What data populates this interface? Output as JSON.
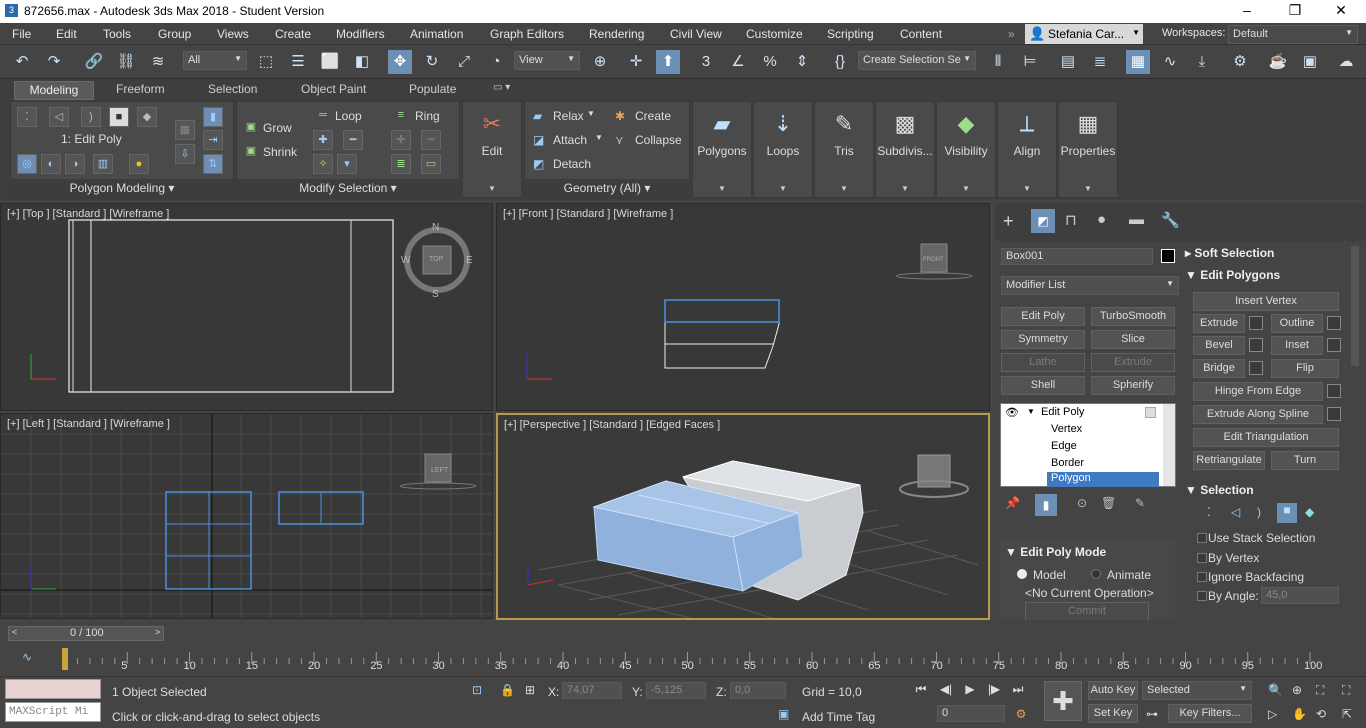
{
  "window": {
    "title": "872656.max - Autodesk 3ds Max 2018 - Student Version",
    "controls": [
      "–",
      "❐",
      "✕"
    ]
  },
  "menu": [
    "File",
    "Edit",
    "Tools",
    "Group",
    "Views",
    "Create",
    "Modifiers",
    "Animation",
    "Graph Editors",
    "Rendering",
    "Civil View",
    "Customize",
    "Scripting",
    "Content"
  ],
  "user": {
    "name": "Stefania Car...",
    "workspaces_label": "Workspaces:",
    "workspace": "Default"
  },
  "toolbar": {
    "filter": "All",
    "ref_coord": "View",
    "selection_set": "Create Selection Se"
  },
  "ribbon": {
    "tabs": [
      "Modeling",
      "Freeform",
      "Selection",
      "Object Paint",
      "Populate"
    ],
    "active_tab": "Modeling",
    "edit_poly_label": "1: Edit Poly",
    "panel_polygon_modeling": "Polygon Modeling",
    "grow": "Grow",
    "shrink": "Shrink",
    "loop": "Loop",
    "ring": "Ring",
    "panel_modify_selection": "Modify Selection",
    "edit": "Edit",
    "relax": "Relax",
    "attach": "Attach",
    "detach": "Detach",
    "create": "Create",
    "collapse": "Collapse",
    "panel_geometry": "Geometry (All)",
    "big_buttons": [
      "Polygons",
      "Loops",
      "Tris",
      "Subdivis...",
      "Visibility",
      "Align",
      "Properties"
    ]
  },
  "viewports": {
    "top": "[+] [Top ] [Standard ] [Wireframe ]",
    "front": "[+] [Front ] [Standard ] [Wireframe ]",
    "left": "[+] [Left ] [Standard ] [Wireframe ]",
    "perspective": "[+] [Perspective ] [Standard ] [Edged Faces ]",
    "compass": {
      "n": "N",
      "s": "S",
      "e": "E",
      "w": "W",
      "cube_top": "TOP",
      "cube_front": "FRONT",
      "cube_left": "LEFT"
    }
  },
  "command_panel": {
    "object_name": "Box001",
    "modifier_list": "Modifier List",
    "modifier_buttons": [
      {
        "label": "Edit Poly",
        "enabled": true
      },
      {
        "label": "TurboSmooth",
        "enabled": true
      },
      {
        "label": "Symmetry",
        "enabled": true
      },
      {
        "label": "Slice",
        "enabled": true
      },
      {
        "label": "Lathe",
        "enabled": false
      },
      {
        "label": "Extrude",
        "enabled": false
      },
      {
        "label": "Shell",
        "enabled": true
      },
      {
        "label": "Spherify",
        "enabled": true
      }
    ],
    "stack": [
      "Edit Poly",
      "Vertex",
      "Edge",
      "Border",
      "Polygon"
    ],
    "edit_poly_mode": {
      "title": "Edit Poly Mode",
      "model": "Model",
      "animate": "Animate",
      "operation": "<No Current Operation>",
      "commit": "Commit"
    },
    "soft_selection": "Soft Selection",
    "edit_polygons": {
      "title": "Edit Polygons",
      "insert_vertex": "Insert Vertex",
      "extrude": "Extrude",
      "outline": "Outline",
      "bevel": "Bevel",
      "inset": "Inset",
      "bridge": "Bridge",
      "flip": "Flip",
      "hinge": "Hinge From Edge",
      "extrude_spline": "Extrude Along Spline",
      "edit_tri": "Edit Triangulation",
      "retriangulate": "Retriangulate",
      "turn": "Turn"
    },
    "selection": {
      "title": "Selection",
      "use_stack": "Use Stack Selection",
      "by_vertex": "By Vertex",
      "ignore_backfacing": "Ignore Backfacing",
      "by_angle": "By Angle:",
      "angle": "45,0"
    }
  },
  "timeline": {
    "frame": "0 / 100",
    "ticks": [
      "5",
      "10",
      "15",
      "20",
      "25",
      "30",
      "35",
      "40",
      "45",
      "50",
      "55",
      "60",
      "65",
      "70",
      "75",
      "80",
      "85",
      "90",
      "95",
      "100"
    ]
  },
  "status": {
    "selected": "1 Object Selected",
    "hint": "Click or click-and-drag to select objects",
    "maxscript": "MAXScript Mi",
    "x_label": "X:",
    "x": "74,07",
    "y_label": "Y:",
    "y": "-5,125",
    "z_label": "Z:",
    "z": "0,0",
    "grid": "Grid = 10,0",
    "add_time_tag": "Add Time Tag",
    "auto_key": "Auto Key",
    "set_key": "Set Key",
    "key_mode": "Selected",
    "key_filters": "Key Filters...",
    "current_frame": "0"
  }
}
